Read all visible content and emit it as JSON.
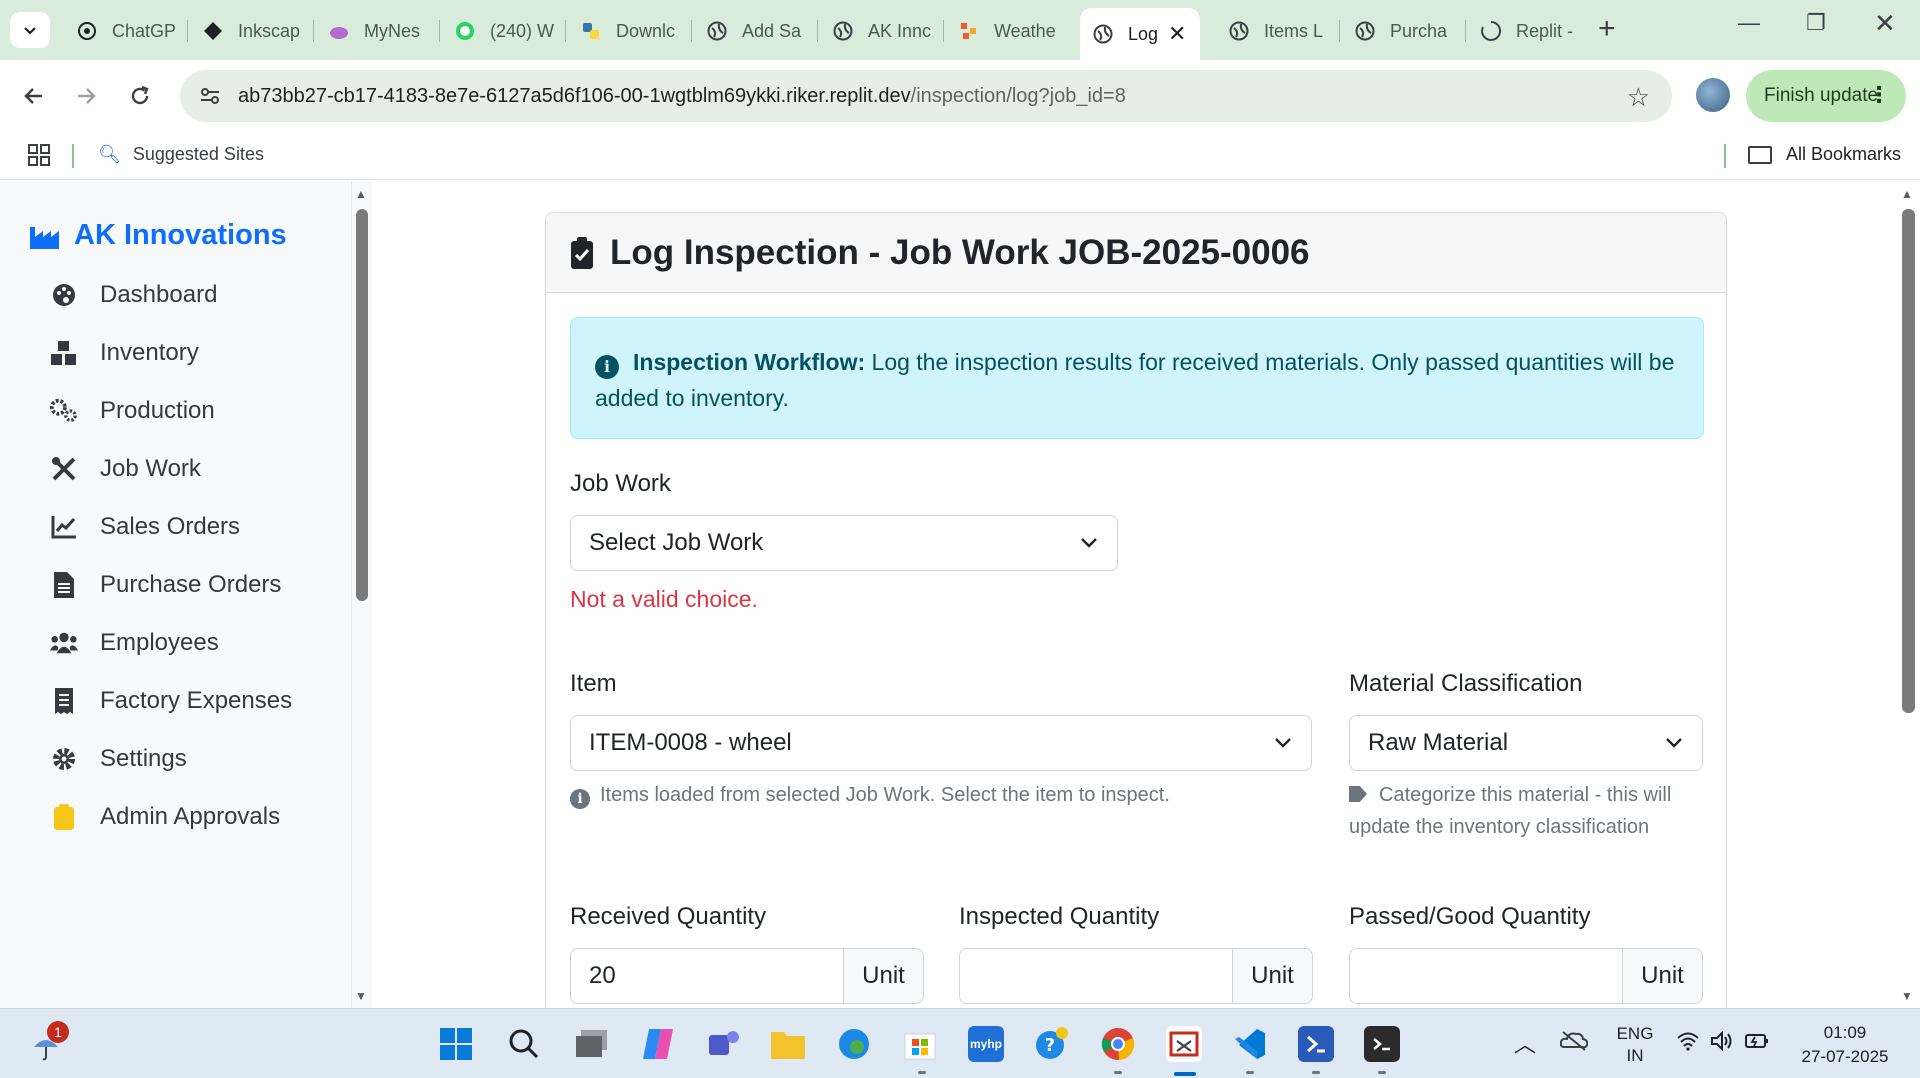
{
  "browser": {
    "tabs": [
      {
        "label": "ChatGP",
        "icon": "chatgpt-icon"
      },
      {
        "label": "Inkscap",
        "icon": "inkscape-icon"
      },
      {
        "label": "MyNes",
        "icon": "cloud-icon"
      },
      {
        "label": "(240) W",
        "icon": "whatsapp-icon"
      },
      {
        "label": "Downlc",
        "icon": "python-icon"
      },
      {
        "label": "Add Sa",
        "icon": "globe-icon"
      },
      {
        "label": "AK Innc",
        "icon": "globe-icon"
      },
      {
        "label": "Weathe",
        "icon": "weather-app-icon"
      },
      {
        "label": "Log",
        "icon": "globe-icon",
        "active": true
      },
      {
        "label": "Items L",
        "icon": "globe-icon"
      },
      {
        "label": "Purcha",
        "icon": "globe-icon"
      },
      {
        "label": "Replit -",
        "icon": "replit-loading-icon"
      }
    ],
    "url_host": "ab73bb27-cb17-4183-8e7e-6127a5d6f106-00-1wgtblm69ykki.riker.replit.dev",
    "url_path": "/inspection/log?job_id=8",
    "finish_update_label": "Finish update",
    "bookmarks": {
      "suggested": "Suggested Sites",
      "all": "All Bookmarks"
    }
  },
  "sidebar": {
    "brand": "AK Innovations",
    "items": [
      {
        "label": "Dashboard",
        "icon": "palette-icon"
      },
      {
        "label": "Inventory",
        "icon": "boxes-icon"
      },
      {
        "label": "Production",
        "icon": "gears-icon"
      },
      {
        "label": "Job Work",
        "icon": "tools-icon"
      },
      {
        "label": "Sales Orders",
        "icon": "line-chart-icon"
      },
      {
        "label": "Purchase Orders",
        "icon": "document-icon"
      },
      {
        "label": "Employees",
        "icon": "users-icon"
      },
      {
        "label": "Factory Expenses",
        "icon": "receipt-icon"
      },
      {
        "label": "Settings",
        "icon": "gear-icon"
      },
      {
        "label": "Admin Approvals",
        "icon": "clipboard-check-icon"
      }
    ]
  },
  "main": {
    "title": "Log Inspection - Job Work JOB-2025-0006",
    "alert": {
      "strong": "Inspection Workflow:",
      "text": " Log the inspection results for received materials. Only passed quantities will be added to inventory."
    },
    "job_work": {
      "label": "Job Work",
      "selected": "Select Job Work",
      "error": "Not a valid choice."
    },
    "item": {
      "label": "Item",
      "selected": "ITEM-0008 - wheel",
      "help": "Items loaded from selected Job Work. Select the item to inspect."
    },
    "classification": {
      "label": "Material Classification",
      "selected": "Raw Material",
      "help": "Categorize this material - this will update the inventory classification"
    },
    "received": {
      "label": "Received Quantity",
      "value": "20",
      "unit": "Unit"
    },
    "inspected": {
      "label": "Inspected Quantity",
      "value": "",
      "unit": "Unit"
    },
    "passed": {
      "label": "Passed/Good Quantity",
      "value": "",
      "unit": "Unit"
    }
  },
  "taskbar": {
    "notification_count": "1",
    "lang_line1": "ENG",
    "lang_line2": "IN",
    "time": "01:09",
    "date": "27-07-2025",
    "apps": [
      "start-icon",
      "search-icon",
      "task-view-icon",
      "copilot-icon",
      "teams-icon",
      "file-explorer-icon",
      "edge-icon",
      "store-icon",
      "myhp-icon",
      "help-icon",
      "chrome-icon",
      "snipping-tool-icon",
      "vscode-icon",
      "powershell-icon",
      "terminal-icon"
    ]
  },
  "colors": {
    "brand": "#0d6efd",
    "alert_bg": "#cff4fc",
    "alert_text": "#055160",
    "error": "#dc3545",
    "tabbar": "#d9ecdc",
    "finish_update": "#bfe8b8"
  }
}
